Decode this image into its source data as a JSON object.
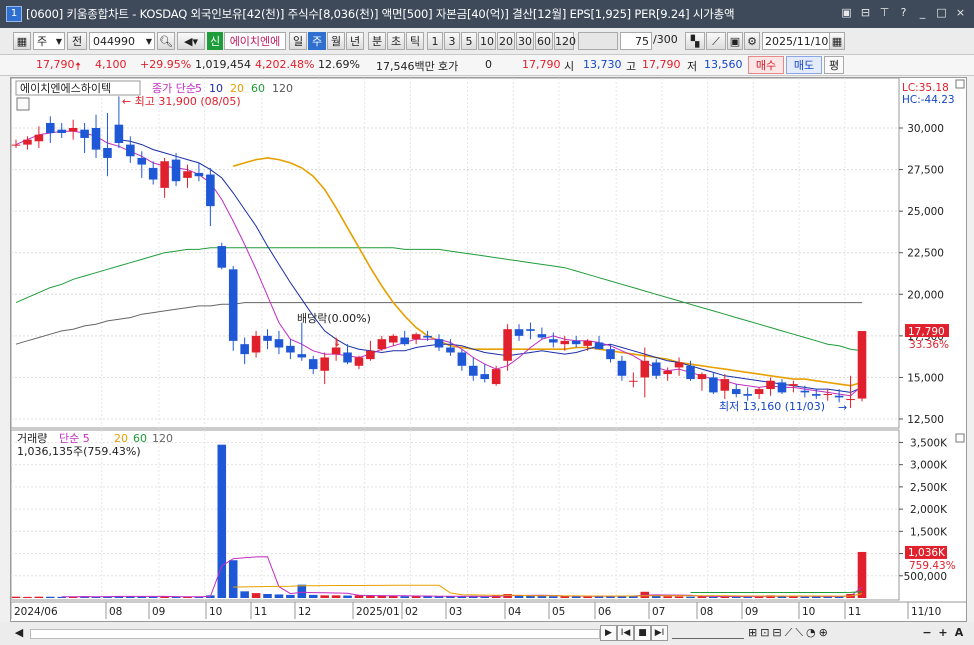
{
  "window": {
    "number": "1",
    "title": "[0600] 키움종합차트 - KOSDAQ 외국인보유[42(천)] 주식수[8,036(천)] 액면[500] 자본금[40(억)] 결산[12월] EPS[1,925] PER[9.24] 시가총액",
    "controls": [
      "▣",
      "⊟",
      "⊤",
      "?",
      "_",
      "□",
      "×"
    ]
  },
  "toolbar": {
    "period_select": "주",
    "prev_label": "전",
    "code": "044990",
    "new_badge": "신",
    "stock_name": "에이치엔에",
    "timeframes": [
      "일",
      "주",
      "월",
      "년",
      "분",
      "초",
      "틱"
    ],
    "selected_timeframe": "주",
    "intervals": [
      "1",
      "3",
      "5",
      "10",
      "20",
      "30",
      "60",
      "120"
    ],
    "count": "75",
    "count_total": "/300",
    "date": "2025/11/10"
  },
  "quote": {
    "price": "17,790",
    "change": "4,100",
    "change_pct": "+29.95%",
    "volume": "1,019,454",
    "volume_pct": "4,202.48%",
    "turnover": "12.69%",
    "amount": "17,546백만",
    "hoga_label": "호가",
    "hoga_value": "0",
    "current": "17,790",
    "open_label": "시",
    "open": "13,730",
    "high_label": "고",
    "high": "17,790",
    "low_label": "저",
    "low": "13,560",
    "buy": "매수",
    "sell": "매도",
    "eval": "평"
  },
  "chart_data": [
    {
      "type": "candlestick",
      "title": "에이치엔에스하이텍",
      "legend": {
        "label": "종가 단순",
        "periods": [
          "5",
          "10",
          "20",
          "60",
          "120"
        ],
        "colors": [
          "#c22dc2",
          "#1a2ea8",
          "#e8a000",
          "#1f9c3a",
          "#555555"
        ]
      },
      "yticks": [
        "30,000",
        "27,500",
        "25,000",
        "22,500",
        "20,000",
        "17,500",
        "15,000",
        "12,500"
      ],
      "ylim": [
        12000,
        36000
      ],
      "x": [
        "2024/06",
        "08",
        "09",
        "10",
        "11",
        "12",
        "2025/01",
        "02",
        "03",
        "04",
        "05",
        "06",
        "07",
        "08",
        "09",
        "10",
        "11",
        "11/10"
      ],
      "candles": [
        [
          29000,
          29300,
          28800,
          29000
        ],
        [
          29000,
          29500,
          28700,
          29300
        ],
        [
          29200,
          30100,
          28800,
          29600
        ],
        [
          30300,
          30700,
          29100,
          29700
        ],
        [
          29900,
          30300,
          29400,
          29700
        ],
        [
          29800,
          30500,
          29300,
          30000
        ],
        [
          29900,
          30300,
          28500,
          29400
        ],
        [
          30000,
          30800,
          28200,
          28700
        ],
        [
          28800,
          30900,
          27100,
          28200
        ],
        [
          30200,
          31900,
          28800,
          29100
        ],
        [
          29000,
          29500,
          27900,
          28300
        ],
        [
          28200,
          28600,
          27000,
          27800
        ],
        [
          27600,
          28000,
          26600,
          26900
        ],
        [
          26400,
          28200,
          25800,
          28000
        ],
        [
          28100,
          28500,
          26500,
          26800
        ],
        [
          27000,
          27800,
          26400,
          27400
        ],
        [
          27300,
          27900,
          26800,
          27100
        ],
        [
          27200,
          27600,
          24100,
          25300
        ],
        [
          22900,
          23100,
          21500,
          21600
        ],
        [
          21500,
          21700,
          16600,
          17200
        ],
        [
          17000,
          17400,
          15800,
          16400
        ],
        [
          16500,
          17800,
          16200,
          17500
        ],
        [
          17500,
          17900,
          16700,
          17200
        ],
        [
          17300,
          17800,
          16400,
          16800
        ],
        [
          16900,
          17300,
          16100,
          16500
        ],
        [
          16400,
          18300,
          16000,
          16200
        ],
        [
          16100,
          16300,
          15200,
          15500
        ],
        [
          15400,
          16500,
          14600,
          16200
        ],
        [
          16400,
          17400,
          16000,
          16800
        ],
        [
          16500,
          17000,
          15800,
          15900
        ],
        [
          15700,
          16300,
          15500,
          16200
        ],
        [
          16100,
          17200,
          16000,
          16600
        ],
        [
          16700,
          17500,
          16600,
          17300
        ],
        [
          17100,
          17600,
          16900,
          17500
        ],
        [
          17400,
          17800,
          16900,
          17000
        ],
        [
          17300,
          17700,
          17000,
          17600
        ],
        [
          17500,
          17800,
          17200,
          17400
        ],
        [
          17300,
          17600,
          16600,
          16800
        ],
        [
          16800,
          17300,
          16300,
          16500
        ],
        [
          16500,
          16700,
          15400,
          15700
        ],
        [
          15700,
          16200,
          14800,
          15100
        ],
        [
          15200,
          15800,
          14700,
          14900
        ],
        [
          14600,
          15700,
          14500,
          15500
        ],
        [
          16000,
          18200,
          15400,
          17900
        ],
        [
          17900,
          18200,
          17200,
          17500
        ],
        [
          17900,
          18300,
          17300,
          17800
        ],
        [
          17600,
          18000,
          17300,
          17400
        ],
        [
          17300,
          17700,
          16800,
          17100
        ],
        [
          17000,
          17500,
          16600,
          17200
        ],
        [
          17200,
          17500,
          16800,
          17000
        ],
        [
          16900,
          17300,
          16600,
          17200
        ],
        [
          17100,
          17500,
          16800,
          16700
        ],
        [
          16700,
          17000,
          15900,
          16100
        ],
        [
          16000,
          16300,
          14800,
          15100
        ],
        [
          14800,
          15300,
          14400,
          14800
        ],
        [
          15000,
          16800,
          13800,
          16000
        ],
        [
          15900,
          16100,
          14900,
          15100
        ],
        [
          15200,
          15600,
          14800,
          15400
        ],
        [
          15600,
          16200,
          15100,
          15900
        ],
        [
          15700,
          16000,
          14800,
          14900
        ],
        [
          14900,
          15300,
          14200,
          15200
        ],
        [
          15000,
          15300,
          14000,
          14100
        ],
        [
          14200,
          15200,
          13700,
          14900
        ],
        [
          14300,
          14600,
          13800,
          14000
        ],
        [
          14000,
          14400,
          13600,
          13900
        ],
        [
          14000,
          14400,
          13700,
          14300
        ],
        [
          14300,
          15000,
          13900,
          14800
        ],
        [
          14700,
          14900,
          14000,
          14100
        ],
        [
          14500,
          14800,
          14100,
          14600
        ],
        [
          14200,
          14500,
          13800,
          14100
        ],
        [
          14000,
          14300,
          13700,
          13900
        ],
        [
          14000,
          14300,
          13600,
          14000
        ],
        [
          13900,
          14300,
          13500,
          13800
        ],
        [
          13700,
          15100,
          13160,
          13700
        ],
        [
          13730,
          17790,
          13560,
          17790
        ]
      ],
      "ma5": [
        29000,
        29300,
        29600,
        29700,
        29800,
        29800,
        29700,
        29500,
        29100,
        28900,
        28600,
        28300,
        27900,
        27700,
        27600,
        27500,
        27200,
        26700,
        25700,
        24400,
        23000,
        21500,
        19900,
        18300,
        17300,
        17000,
        16600,
        16400,
        16400,
        16300,
        16200,
        16400,
        16700,
        16900,
        17100,
        17300,
        17300,
        17300,
        17100,
        16700,
        16200,
        15800,
        15500,
        15700,
        16200,
        16800,
        17300,
        17500,
        17300,
        17200,
        17200,
        17100,
        16900,
        16600,
        16300,
        15900,
        15600,
        15400,
        15500,
        15300,
        15100,
        14900,
        14800,
        14600,
        14500,
        14400,
        14500,
        14400,
        14400,
        14300,
        14200,
        14100,
        14000,
        13900,
        14500
      ],
      "ma10": [
        null,
        null,
        null,
        null,
        null,
        null,
        null,
        null,
        null,
        29300,
        29200,
        29000,
        28700,
        28500,
        28300,
        28100,
        27900,
        27500,
        27000,
        26100,
        25100,
        24100,
        22900,
        21800,
        20700,
        19700,
        18700,
        17800,
        17300,
        16900,
        16700,
        16600,
        16500,
        16600,
        16600,
        16800,
        16900,
        17000,
        17000,
        16900,
        16700,
        16500,
        16400,
        16300,
        16400,
        16500,
        16600,
        16500,
        16400,
        16500,
        16700,
        16900,
        17000,
        16800,
        16600,
        16400,
        16200,
        16000,
        15900,
        15700,
        15500,
        15300,
        15100,
        15000,
        14900,
        14800,
        14700,
        14600,
        14500,
        14400,
        14300,
        14300,
        14200,
        14100,
        14400
      ],
      "ma20": [
        null,
        null,
        null,
        null,
        null,
        null,
        null,
        null,
        null,
        null,
        null,
        null,
        null,
        null,
        null,
        null,
        null,
        null,
        null,
        27700,
        27900,
        28100,
        28200,
        28100,
        27900,
        27600,
        27100,
        26300,
        25200,
        24000,
        22800,
        21600,
        20500,
        19500,
        18700,
        18000,
        17500,
        17200,
        16900,
        16800,
        16700,
        16700,
        16700,
        16700,
        16700,
        16700,
        16700,
        16700,
        16700,
        16800,
        16800,
        16700,
        16600,
        16500,
        16400,
        16300,
        16200,
        16100,
        15900,
        15800,
        15700,
        15600,
        15500,
        15400,
        15300,
        15200,
        15100,
        15000,
        14900,
        14900,
        14800,
        14700,
        14600,
        14500,
        14700
      ],
      "ma60": [
        19500,
        19800,
        20100,
        20400,
        20600,
        20900,
        21100,
        21300,
        21500,
        21700,
        21900,
        22100,
        22300,
        22500,
        22600,
        22700,
        22700,
        22800,
        22800,
        22800,
        22800,
        22800,
        22800,
        22800,
        22800,
        22800,
        22800,
        22800,
        22800,
        22800,
        22800,
        22800,
        22800,
        22800,
        22700,
        22700,
        22700,
        22700,
        22600,
        22500,
        22400,
        22300,
        22200,
        22100,
        22000,
        21900,
        21800,
        21700,
        21600,
        21400,
        21200,
        21000,
        20800,
        20600,
        20400,
        20200,
        20000,
        19800,
        19600,
        19400,
        19200,
        19000,
        18800,
        18600,
        18400,
        18200,
        18000,
        17800,
        17600,
        17400,
        17200,
        17000,
        16900,
        16700,
        16600
      ],
      "ma120": [
        17000,
        17200,
        17400,
        17600,
        17800,
        17900,
        18100,
        18200,
        18400,
        18500,
        18600,
        18800,
        18900,
        19000,
        19100,
        19200,
        19300,
        19300,
        19400,
        19400,
        19500,
        19500,
        19500,
        19500,
        19500,
        19500,
        19500,
        19500,
        19500,
        19500,
        19500,
        19500,
        19500,
        19500,
        19500,
        19500,
        19500,
        19500,
        19500,
        19500,
        19500,
        19500,
        19500,
        19500,
        19500,
        19500,
        19500,
        19500,
        19500,
        19500,
        19500,
        19500,
        19500,
        19500,
        19500,
        19500,
        19500,
        19500,
        19500,
        19500,
        19500,
        19500,
        19500,
        19500,
        19500,
        19500,
        19500,
        19500,
        19500,
        19500,
        19500,
        19500,
        19500,
        19500,
        19500
      ],
      "annotations": {
        "high": "최고 31,900 (08/05)",
        "low": "최저 13,160 (11/03)",
        "dividend": "배당락(0.00%)",
        "lc": "LC:35.18",
        "hc": "HC:-44.23",
        "last_price": "17,790",
        "last_pct": "33.36%"
      }
    },
    {
      "type": "bar",
      "title": "거래량",
      "legend": {
        "label": "단순",
        "periods": [
          "5",
          "20",
          "60",
          "120"
        ]
      },
      "yticks": [
        "3,500K",
        "3,000K",
        "2,500K",
        "2,000K",
        "1,500K",
        "1,000K",
        "500,000"
      ],
      "ylim": [
        0,
        3600000
      ],
      "summary": "1,036,135주(759.43%)",
      "last_label": "1,036K",
      "last_pct": "759.43%",
      "values": [
        30000,
        25000,
        30000,
        28000,
        25000,
        30000,
        40000,
        25000,
        35000,
        45000,
        40000,
        30000,
        28000,
        32000,
        30000,
        30000,
        28000,
        60000,
        3450000,
        850000,
        150000,
        110000,
        90000,
        80000,
        70000,
        300000,
        70000,
        60000,
        60000,
        55000,
        60000,
        50000,
        50000,
        45000,
        40000,
        45000,
        40000,
        35000,
        40000,
        35000,
        40000,
        30000,
        60000,
        90000,
        60000,
        50000,
        45000,
        40000,
        35000,
        40000,
        35000,
        40000,
        50000,
        45000,
        50000,
        140000,
        60000,
        40000,
        35000,
        30000,
        35000,
        30000,
        40000,
        30000,
        30000,
        35000,
        60000,
        40000,
        35000,
        30000,
        35000,
        30000,
        40000,
        90000,
        1036135
      ],
      "up": [
        true,
        true,
        true,
        false,
        false,
        true,
        false,
        false,
        false,
        false,
        false,
        false,
        false,
        true,
        false,
        true,
        false,
        false,
        false,
        false,
        false,
        true,
        false,
        false,
        false,
        false,
        false,
        true,
        true,
        false,
        true,
        true,
        true,
        true,
        false,
        true,
        false,
        false,
        false,
        false,
        false,
        false,
        true,
        true,
        false,
        false,
        false,
        false,
        true,
        false,
        true,
        false,
        false,
        false,
        false,
        true,
        false,
        true,
        true,
        false,
        true,
        false,
        true,
        false,
        false,
        true,
        true,
        false,
        true,
        false,
        false,
        false,
        false,
        true,
        true
      ]
    }
  ],
  "bottom": {
    "left_icon": "◀",
    "nav": [
      "▶",
      "I◀",
      "■",
      "▶I"
    ],
    "right": [
      "−",
      "+",
      "A"
    ]
  }
}
